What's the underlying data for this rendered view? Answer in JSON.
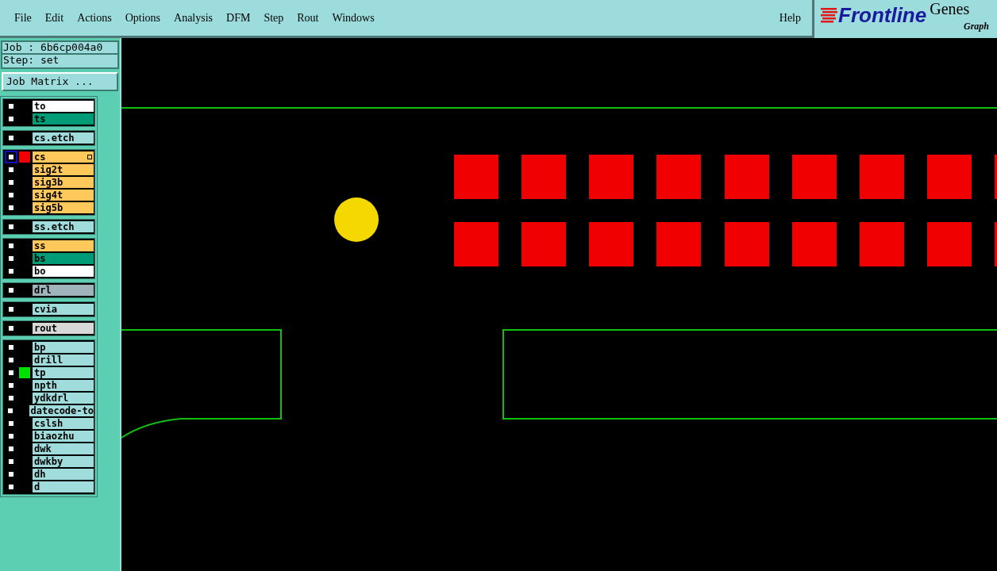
{
  "menu": [
    {
      "label": "File"
    },
    {
      "label": "Edit"
    },
    {
      "label": "Actions"
    },
    {
      "label": "Options"
    },
    {
      "label": "Analysis"
    },
    {
      "label": "DFM"
    },
    {
      "label": "Step"
    },
    {
      "label": "Rout"
    },
    {
      "label": "Windows"
    }
  ],
  "help": "Help",
  "logo": {
    "brand": "Frontline",
    "product": "Genes",
    "subtitle": "Graph"
  },
  "job": "Job : 6b6cp004a0",
  "step": "Step: set",
  "job_matrix_button": "Job Matrix ...",
  "layer_groups": [
    {
      "layers": [
        {
          "name": "to",
          "kind": "silk",
          "work": false,
          "affected": false
        },
        {
          "name": "ts",
          "kind": "mask",
          "work": false,
          "affected": false
        }
      ]
    },
    {
      "layers": [
        {
          "name": "cs.etch",
          "kind": "document",
          "work": false,
          "affected": false
        }
      ]
    },
    {
      "layers": [
        {
          "name": "cs",
          "kind": "signal",
          "color": "#f00000",
          "work": true,
          "affected": false
        },
        {
          "name": "sig2t",
          "kind": "signal",
          "work": false,
          "affected": false
        },
        {
          "name": "sig3b",
          "kind": "signal",
          "work": false,
          "affected": false
        },
        {
          "name": "sig4t",
          "kind": "signal",
          "work": false,
          "affected": false
        },
        {
          "name": "sig5b",
          "kind": "signal",
          "work": false,
          "affected": false
        }
      ]
    },
    {
      "layers": [
        {
          "name": "ss.etch",
          "kind": "document",
          "work": false,
          "affected": false
        }
      ]
    },
    {
      "layers": [
        {
          "name": "ss",
          "kind": "signal",
          "work": false,
          "affected": false
        },
        {
          "name": "bs",
          "kind": "mask",
          "work": false,
          "affected": false
        },
        {
          "name": "bo",
          "kind": "silk",
          "work": false,
          "affected": false
        }
      ]
    },
    {
      "layers": [
        {
          "name": "drl",
          "kind": "drill",
          "work": false,
          "affected": false
        }
      ]
    },
    {
      "layers": [
        {
          "name": "cvia",
          "kind": "document",
          "work": false,
          "affected": false
        }
      ]
    },
    {
      "layers": [
        {
          "name": "rout",
          "kind": "rout",
          "work": false,
          "affected": false
        }
      ]
    },
    {
      "layers": [
        {
          "name": "bp",
          "kind": "document",
          "work": false,
          "affected": false
        },
        {
          "name": "drill",
          "kind": "document",
          "work": false,
          "affected": false
        },
        {
          "name": "tp",
          "kind": "document",
          "color": "#00e000",
          "work": false,
          "affected": false
        },
        {
          "name": "npth",
          "kind": "document",
          "work": false,
          "affected": false
        },
        {
          "name": "ydkdrl",
          "kind": "document",
          "work": false,
          "affected": false
        },
        {
          "name": "datecode-to",
          "kind": "document",
          "work": false,
          "affected": false
        },
        {
          "name": "cslsh",
          "kind": "document",
          "work": false,
          "affected": false
        },
        {
          "name": "biaozhu",
          "kind": "document",
          "work": false,
          "affected": false
        },
        {
          "name": "dwk",
          "kind": "document",
          "work": false,
          "affected": false
        },
        {
          "name": "dwkby",
          "kind": "document",
          "work": false,
          "affected": false
        },
        {
          "name": "dh",
          "kind": "document",
          "work": false,
          "affected": false
        },
        {
          "name": "d",
          "kind": "document",
          "work": false,
          "affected": false
        }
      ]
    }
  ]
}
